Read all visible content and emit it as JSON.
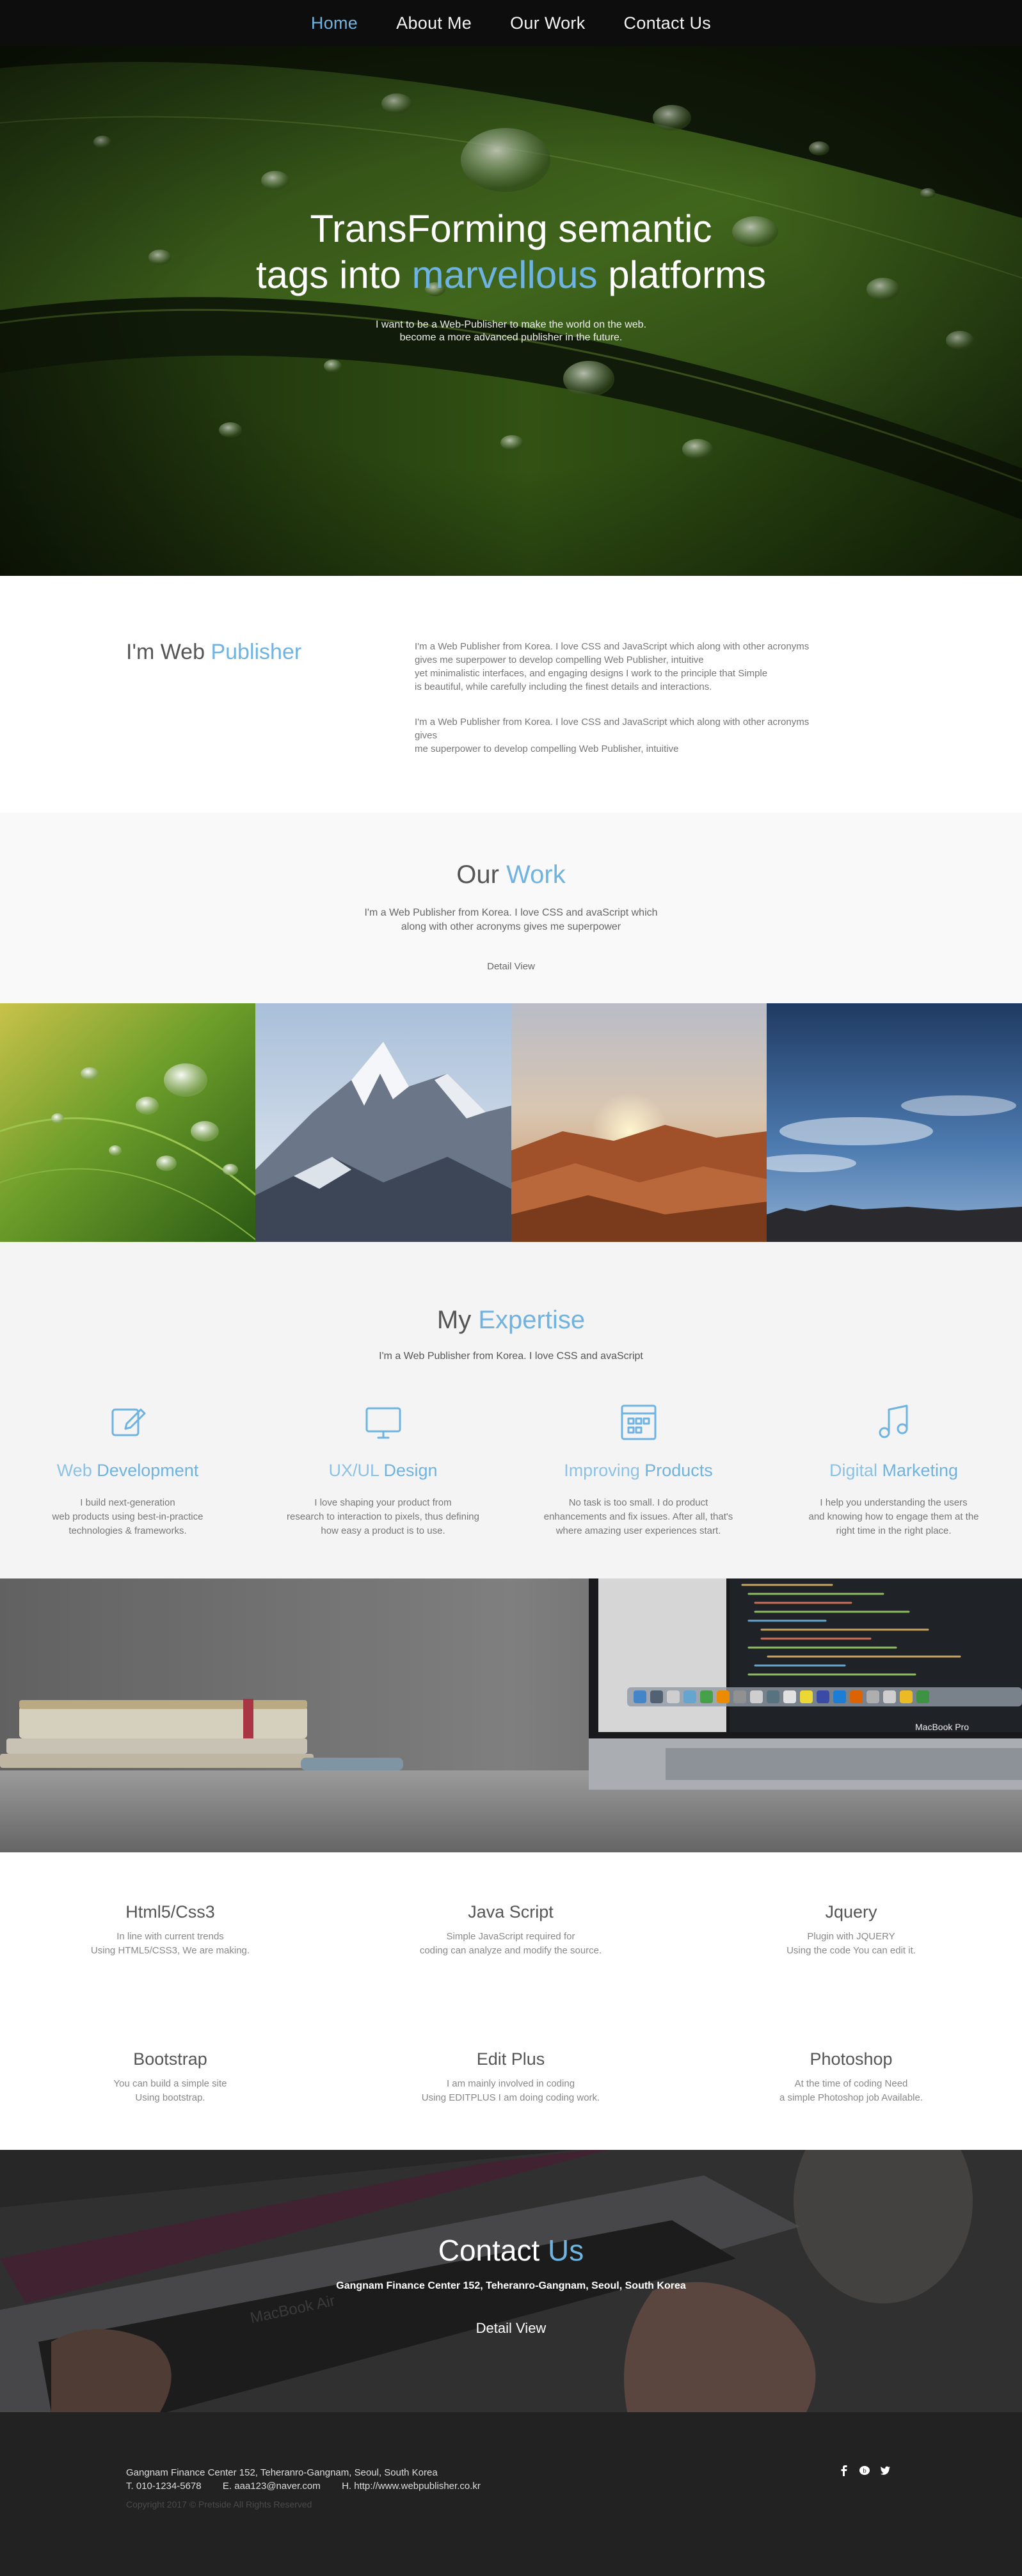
{
  "nav": {
    "items": [
      {
        "label": "Home"
      },
      {
        "label": "About Me"
      },
      {
        "label": "Our Work"
      },
      {
        "label": "Contact Us"
      }
    ]
  },
  "hero": {
    "title_line1": "TransForming semantic",
    "title_line2_prefix": "tags into ",
    "title_line2_accent": "marvellous",
    "title_line2_suffix": " platforms",
    "subtitle_line1": "I want to be a Web-Publisher to make the world on the web.",
    "subtitle_line2": "become a more advanced publisher in the future."
  },
  "about": {
    "title_prefix": "I'm Web ",
    "title_accent": "Publisher",
    "para1_l1": "I'm a Web Publisher from Korea. I love CSS and JavaScript which along with other acronyms",
    "para1_l2": "gives me superpower to develop compelling Web Publisher, intuitive",
    "para1_l3": "yet minimalistic interfaces, and engaging designs I work to the principle that Simple",
    "para1_l4": "is beautiful, while carefully including the finest details and interactions.",
    "para2_l1": "I'm a Web Publisher from Korea. I love CSS and JavaScript which along with other acronyms",
    "para2_l2": "gives",
    "para2_l3": "me superpower to develop compelling Web Publisher, intuitive"
  },
  "work": {
    "title_prefix": "Our ",
    "title_accent": "Work",
    "desc_l1": "I'm a Web Publisher from Korea. I love CSS and avaScript which",
    "desc_l2": "along with other acronyms gives me superpower",
    "link": "Detail View"
  },
  "expertise": {
    "title_prefix": "My ",
    "title_accent": "Expertise",
    "desc": "I'm a Web Publisher from Korea. I love CSS and avaScript",
    "items": [
      {
        "icon": "edit-icon",
        "light": "Web ",
        "strong": "Development",
        "l1": "I build next-generation",
        "l2": "web products using best-in-practice",
        "l3": "technologies & frameworks."
      },
      {
        "icon": "monitor-icon",
        "light": "UX/UL ",
        "strong": "Design",
        "l1": "I love shaping your product from",
        "l2": "research to interaction to pixels, thus defining",
        "l3": "how easy a product is to use."
      },
      {
        "icon": "grid-icon",
        "light": "Improving ",
        "strong": "Products",
        "l1": "No task is too small. I do product",
        "l2": "enhancements and fix issues. After all, that's",
        "l3": "where amazing user experiences start."
      },
      {
        "icon": "music-note-icon",
        "light": "Digital ",
        "strong": "Marketing",
        "l1": "I help you understanding the users",
        "l2": "and knowing how to engage them at the",
        "l3": "right time in the right place."
      }
    ]
  },
  "desk": {
    "laptop_label": "MacBook Pro"
  },
  "skills": [
    {
      "title": "Html5/Css3",
      "l1": "In line with current trends",
      "l2": "Using HTML5/CSS3, We are making."
    },
    {
      "title": "Java Script",
      "l1": "Simple JavaScript required for",
      "l2": "coding can analyze and modify the source."
    },
    {
      "title": "Jquery",
      "l1": "Plugin with JQUERY",
      "l2": "Using the code You can edit it."
    },
    {
      "title": "Bootstrap",
      "l1": "You can build a simple site",
      "l2": "Using bootstrap."
    },
    {
      "title": "Edit Plus",
      "l1": "I am mainly involved in coding",
      "l2": "Using EDITPLUS I am doing coding work."
    },
    {
      "title": "Photoshop",
      "l1": "At the time of coding Need",
      "l2": "a simple Photoshop job Available."
    }
  ],
  "contact": {
    "title_prefix": "Contact ",
    "title_accent": "Us",
    "address": "Gangnam Finance Center 152, Teheranro-Gangnam, Seoul, South Korea",
    "link": "Detail View",
    "laptop_label": "MacBook Air"
  },
  "footer": {
    "address": "Gangnam Finance Center 152, Teheranro-Gangnam, Seoul, South Korea",
    "contact_line": "T. 010-1234-5678        E. aaa123@naver.com        H. http://www.webpublisher.co.kr",
    "copyright": "Copyright 2017 © Pretside All Rights Reserved",
    "social": [
      "facebook-icon",
      "blog-icon",
      "twitter-icon"
    ]
  },
  "colors": {
    "accent": "#6fb3e0",
    "nav_bg": "#0d0d0d",
    "footer_bg": "#222222"
  }
}
